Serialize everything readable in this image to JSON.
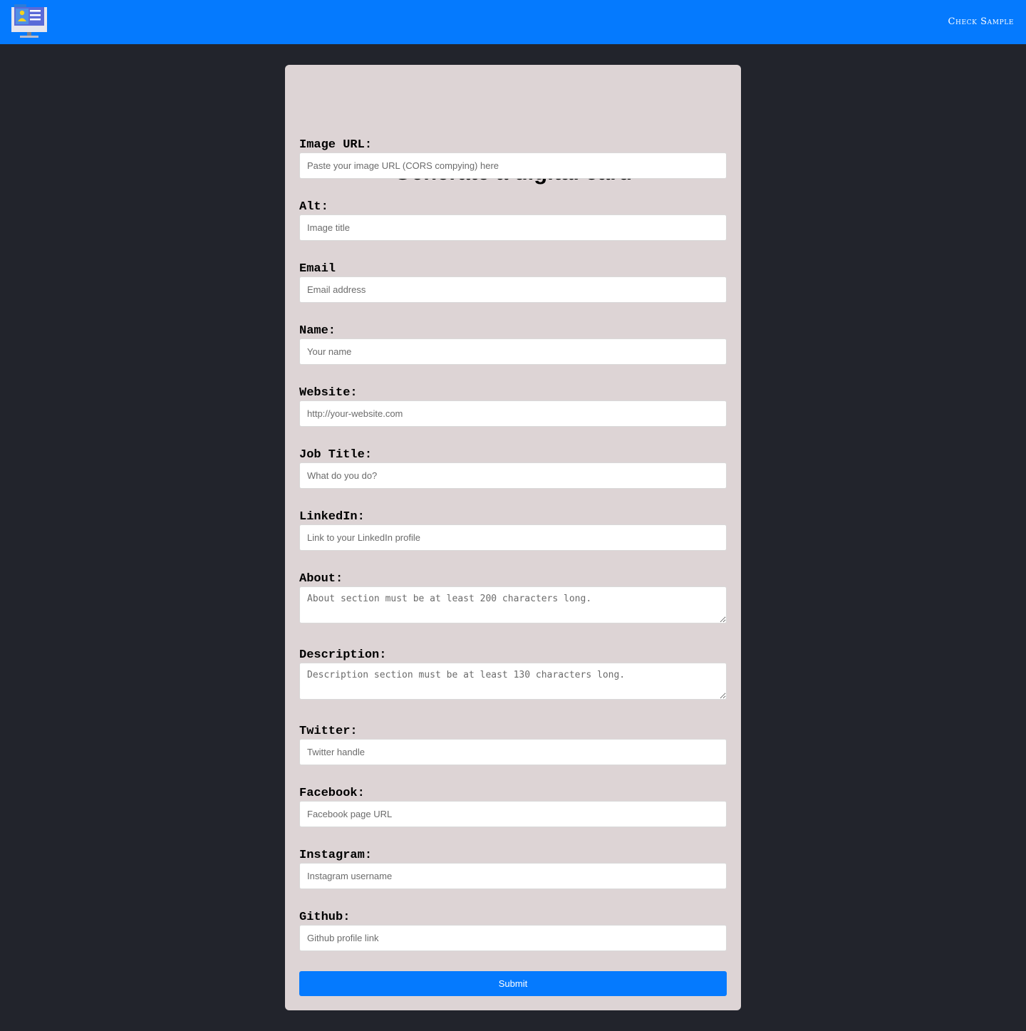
{
  "header": {
    "logo_icon": "digital-card-monitor-icon",
    "check_sample_label": "Check Sample",
    "background_color": "#057afe"
  },
  "form": {
    "title": "Generate a digital card",
    "fields": [
      {
        "label": "Image URL:",
        "placeholder": "Paste your image URL (CORS compying) here",
        "value": ""
      },
      {
        "label": "Alt:",
        "placeholder": "Image title",
        "value": ""
      },
      {
        "label": "Email",
        "placeholder": "Email address",
        "value": ""
      },
      {
        "label": "Name:",
        "placeholder": "Your name",
        "value": ""
      },
      {
        "label": "Website:",
        "placeholder": "http://your-website.com",
        "value": ""
      },
      {
        "label": "Job Title:",
        "placeholder": "What do you do?",
        "value": ""
      },
      {
        "label": "LinkedIn:",
        "placeholder": "Link to your LinkedIn profile",
        "value": ""
      },
      {
        "label": "About:",
        "placeholder": "About section must be at least 200 characters long.",
        "value": ""
      },
      {
        "label": "Description:",
        "placeholder": "Description section must be at least 130 characters long.",
        "value": ""
      },
      {
        "label": "Twitter:",
        "placeholder": "Twitter handle",
        "value": ""
      },
      {
        "label": "Facebook:",
        "placeholder": "Facebook page URL",
        "value": ""
      },
      {
        "label": "Instagram:",
        "placeholder": "Instagram username",
        "value": ""
      },
      {
        "label": "Github:",
        "placeholder": "Github profile link",
        "value": ""
      }
    ],
    "submit_label": "Submit"
  },
  "colors": {
    "page_background": "#22242c",
    "card_background": "#ddd4d5",
    "accent": "#057afe"
  }
}
